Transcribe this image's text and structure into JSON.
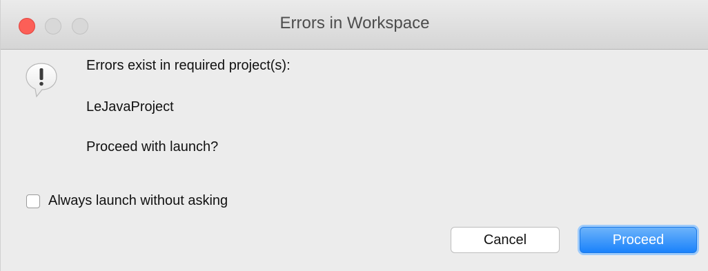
{
  "window": {
    "title": "Errors in Workspace"
  },
  "dialog": {
    "message_line1": "Errors exist in required project(s):",
    "project_name": "LeJavaProject",
    "question": "Proceed with launch?",
    "alert_icon": "alert-exclamation-icon",
    "checkbox_label": "Always launch without asking",
    "checkbox_checked": false
  },
  "buttons": {
    "cancel_label": "Cancel",
    "proceed_label": "Proceed"
  },
  "colors": {
    "close_button": "#fc5f57",
    "primary_button": "#1a82fb"
  }
}
